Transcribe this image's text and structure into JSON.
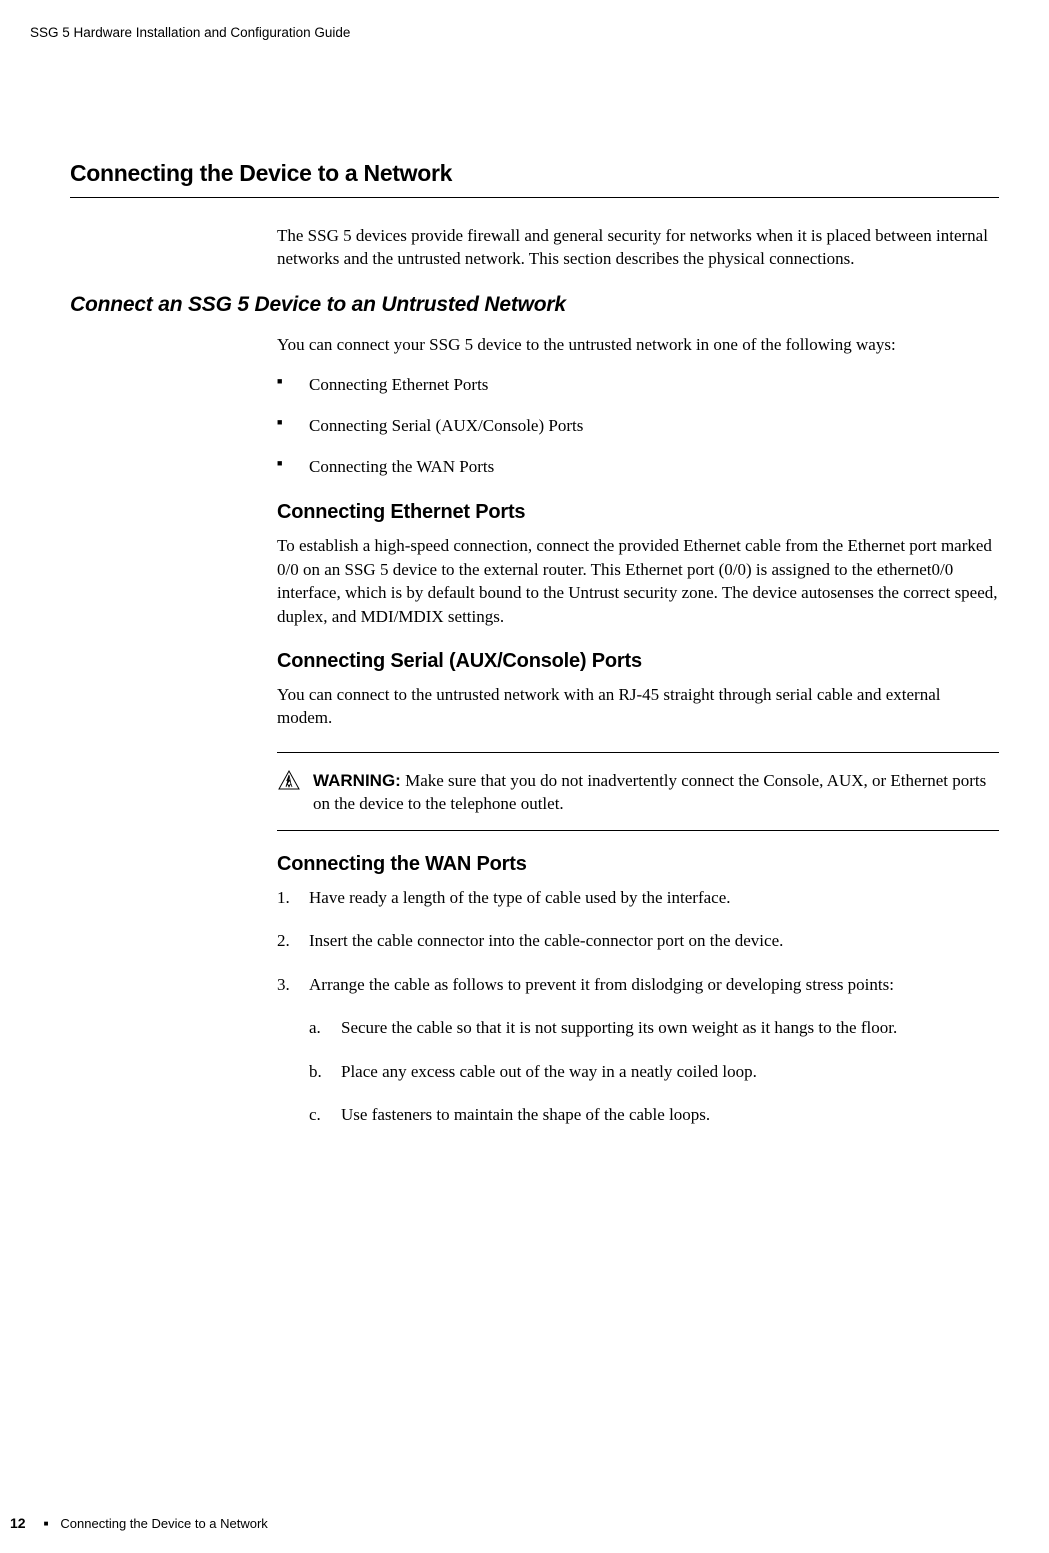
{
  "header": {
    "doc_title": "SSG 5 Hardware Installation and Configuration Guide"
  },
  "section": {
    "title": "Connecting the Device to a Network",
    "intro": "The SSG 5 devices provide firewall and general security for networks when it is placed between internal networks and the untrusted network. This section describes the physical connections."
  },
  "subsection": {
    "title": "Connect an SSG 5 Device to an Untrusted Network",
    "intro": "You can connect your SSG 5 device to the untrusted network in one of the following ways:",
    "bullets": [
      "Connecting Ethernet Ports",
      "Connecting Serial (AUX/Console) Ports",
      "Connecting the WAN Ports"
    ]
  },
  "ethernet": {
    "title": "Connecting Ethernet Ports",
    "body": "To establish a high-speed connection, connect the provided Ethernet cable from the Ethernet port marked 0/0 on an SSG 5 device to the external router. This Ethernet port (0/0) is assigned to the ethernet0/0 interface, which is by default bound to the Untrust security zone. The device autosenses the correct speed, duplex, and MDI/MDIX settings."
  },
  "serial": {
    "title": "Connecting Serial (AUX/Console) Ports",
    "body": "You can connect to the untrusted network with an RJ-45 straight through serial cable and external modem."
  },
  "warning": {
    "label": "WARNING:",
    "text": " Make sure that you do not inadvertently connect the Console, AUX, or Ethernet ports on the device to the telephone outlet."
  },
  "wan": {
    "title": "Connecting the WAN Ports",
    "steps": [
      "Have ready a length of the type of cable used by the interface.",
      "Insert the cable connector into the cable-connector port on the device.",
      "Arrange the cable as follows to prevent it from dislodging or developing stress points:"
    ],
    "substeps": [
      "Secure the cable so that it is not supporting its own weight as it hangs to the floor.",
      "Place any excess cable out of the way in a neatly coiled loop.",
      "Use fasteners to maintain the shape of the cable loops."
    ]
  },
  "footer": {
    "page_number": "12",
    "section_ref": "Connecting the Device to a Network"
  }
}
